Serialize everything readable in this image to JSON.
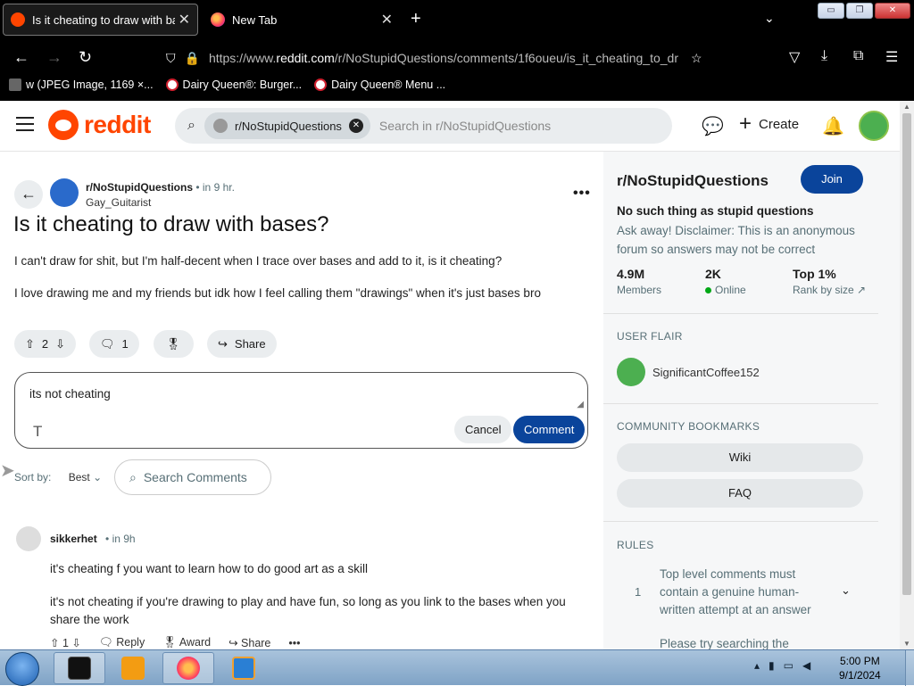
{
  "browser": {
    "tabs": [
      {
        "title": "Is it cheating to draw with bases",
        "close": "✕"
      },
      {
        "title": "New Tab",
        "close": "✕"
      }
    ],
    "new_tab": "+",
    "tabs_menu": "⌄",
    "window_buttons": {
      "min": "▭",
      "restore": "❐",
      "close": "✕"
    },
    "url": {
      "prefix": "https://www.",
      "domain": "reddit.com",
      "path": "/r/NoStupidQuestions/comments/1f6oueu/is_it_cheating_to_dr"
    },
    "bookmarks": [
      "w (JPEG Image, 1169 ×...",
      "Dairy Queen®: Burger...",
      "Dairy Queen® Menu ..."
    ]
  },
  "reddit_header": {
    "logo_text": "reddit",
    "search_chip": "r/NoStupidQuestions",
    "search_placeholder": "Search in r/NoStupidQuestions",
    "create_label": "Create"
  },
  "post": {
    "subreddit": "r/NoStupidQuestions",
    "dot": "•",
    "time": "in 9 hr.",
    "author": "Gay_Guitarist",
    "more": "•••",
    "title": "Is it cheating to draw with bases?",
    "body": [
      "I can't draw for shit, but I'm half-decent when I trace over bases and add to it, is it cheating?",
      "I love drawing me and my friends but idk how I feel calling them \"drawings\" when it's just bases bro"
    ],
    "votes": "2",
    "comments": "1",
    "share_label": "Share"
  },
  "composer": {
    "text": "its not cheating",
    "format_icon": "T",
    "cancel_label": "Cancel",
    "comment_label": "Comment"
  },
  "comments_bar": {
    "sort_label": "Sort by:",
    "sort_value": "Best",
    "search_placeholder": "Search Comments"
  },
  "comment": {
    "author": "sikkerhet",
    "time": "• in 9h",
    "lines": [
      "it's cheating f you want to learn how to do good art as a skill",
      "it's not cheating if you're drawing to play and have fun, so long as you link to the bases when you share the work"
    ],
    "votes": "1",
    "reply_label": "Reply",
    "award_label": "Award",
    "share_label": "Share",
    "more": "•••"
  },
  "sidebar": {
    "name": "r/NoStupidQuestions",
    "join_label": "Join",
    "tagline": "No such thing as stupid questions",
    "description": "Ask away! Disclaimer: This is an anonymous forum so answers may not be correct",
    "stats": [
      {
        "value": "4.9M",
        "label": "Members"
      },
      {
        "value": "2K",
        "label": "Online"
      },
      {
        "value": "Top 1%",
        "label": "Rank by size"
      }
    ],
    "flair_heading": "USER FLAIR",
    "flair_user": "SignificantCoffee152",
    "bookmarks_heading": "COMMUNITY BOOKMARKS",
    "bookmarks": [
      "Wiki",
      "FAQ"
    ],
    "rules_heading": "RULES",
    "rules": [
      {
        "num": "1",
        "text": "Top level comments must contain a genuine human-written attempt at an answer"
      },
      {
        "num": "",
        "text": "Please try searching the"
      }
    ]
  },
  "taskbar": {
    "time": "5:00 PM",
    "date": "9/1/2024"
  },
  "colors": {
    "reddit_orange": "#ff4500",
    "join_blue": "#0a449b",
    "online_green": "#01a816"
  }
}
